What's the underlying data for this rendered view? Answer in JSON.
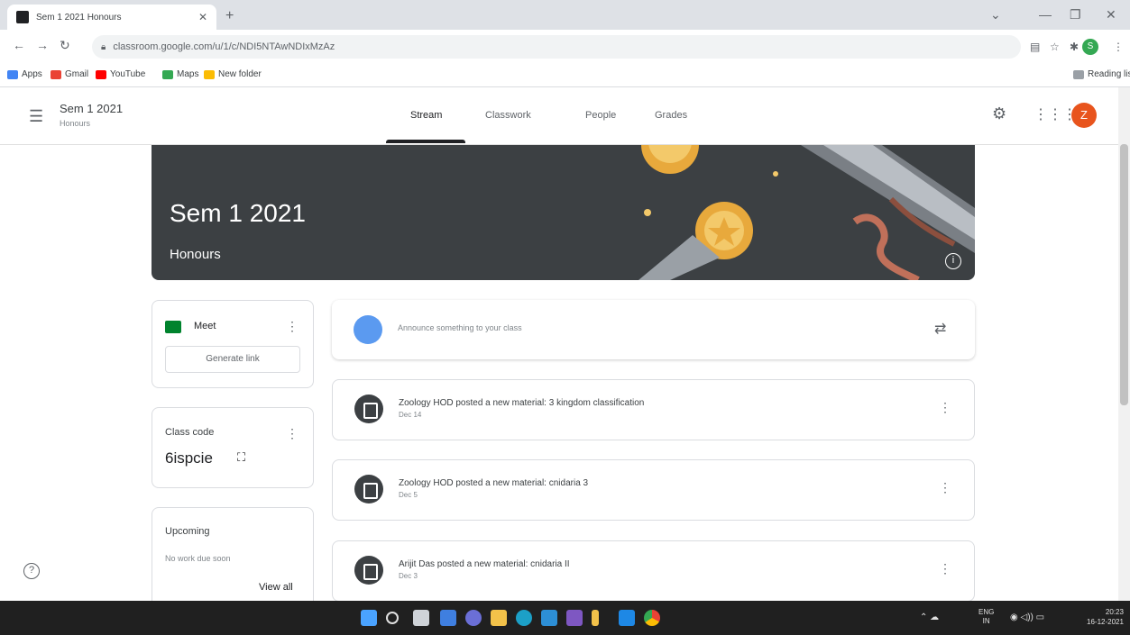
{
  "browser": {
    "tab_title": "Sem 1 2021 Honours",
    "url": "classroom.google.com/u/1/c/NDI5NTAwNDIxMzAz",
    "profile_initial": "S",
    "bookmarks": [
      "Apps",
      "Gmail",
      "YouTube",
      "Maps",
      "New folder"
    ],
    "reading_list": "Reading list"
  },
  "header": {
    "class_name": "Sem 1 2021",
    "class_section": "Honours",
    "tabs": [
      "Stream",
      "Classwork",
      "People",
      "Grades"
    ],
    "active_tab": "Stream",
    "user_initial": "Z"
  },
  "banner": {
    "title": "Sem 1 2021",
    "subtitle": "Honours",
    "bg_color": "#3c4043"
  },
  "sidebar": {
    "meet_label": "Meet",
    "generate_link": "Generate link",
    "class_code_label": "Class code",
    "class_code": "6ispcie",
    "upcoming_label": "Upcoming",
    "upcoming_empty": "No work due soon",
    "view_all": "View all"
  },
  "stream": {
    "announce_placeholder": "Announce something to your class",
    "posts": [
      {
        "title": "Zoology HOD posted a new material: 3 kingdom classification",
        "date": "Dec 14"
      },
      {
        "title": "Zoology HOD posted a new material: cnidaria 3",
        "date": "Dec 5"
      },
      {
        "title": "Arijit Das posted a new material: cnidaria II",
        "date": "Dec 3"
      }
    ]
  },
  "taskbar": {
    "lang_line1": "ENG",
    "lang_line2": "IN",
    "time": "20:23",
    "date": "16-12-2021"
  }
}
